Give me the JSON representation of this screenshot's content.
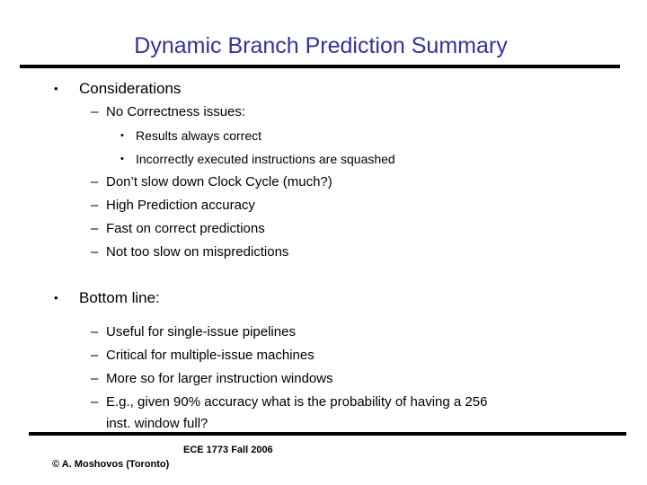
{
  "slide": {
    "title": "Dynamic Branch Prediction Summary",
    "title_color": "#333399",
    "background_color": "#ffffff",
    "rule_color": "#000000",
    "markers": {
      "level1": "•",
      "level2": "–",
      "level3": "•"
    },
    "content": [
      {
        "level": 1,
        "text": "Considerations"
      },
      {
        "level": 2,
        "text": "No Correctness issues:"
      },
      {
        "level": 3,
        "text": "Results always correct"
      },
      {
        "level": 3,
        "text": "Incorrectly executed instructions are squashed"
      },
      {
        "level": 2,
        "text": "Don’t slow down Clock Cycle (much?)"
      },
      {
        "level": 2,
        "text": "High Prediction accuracy"
      },
      {
        "level": 2,
        "text": "Fast on correct predictions"
      },
      {
        "level": 2,
        "text": "Not too slow on mispredictions"
      },
      {
        "level": 1,
        "text": "Bottom line:"
      },
      {
        "level": 2,
        "text": "Useful for single-issue pipelines"
      },
      {
        "level": 2,
        "text": "Critical for multiple-issue machines"
      },
      {
        "level": 2,
        "text": "More so for larger instruction windows"
      },
      {
        "level": 2,
        "text": "E.g., given 90% accuracy what is the probability of having a 256"
      },
      {
        "level": 2,
        "continuation": true,
        "text": "inst. window full?"
      }
    ]
  },
  "footer": {
    "course": "ECE 1773 Fall 2006",
    "copyright": "© A. Moshovos (Toronto)"
  }
}
